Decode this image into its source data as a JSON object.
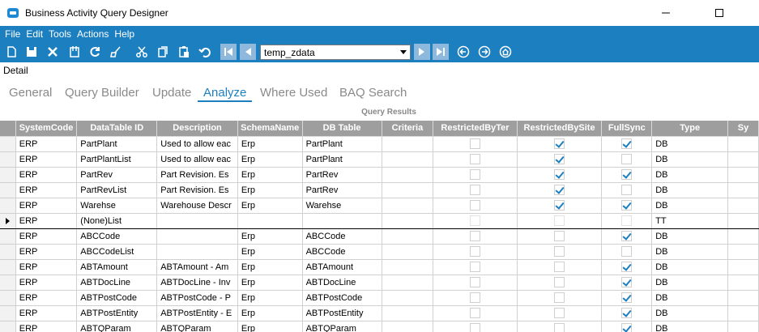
{
  "window": {
    "title": "Business Activity Query Designer"
  },
  "menu": [
    "File",
    "Edit",
    "Tools",
    "Actions",
    "Help"
  ],
  "toolbar": {
    "dataset_value": "temp_zdata"
  },
  "detail_label": "Detail",
  "tabs": [
    "General",
    "Query Builder",
    "Update",
    "Analyze",
    "Where Used",
    "BAQ Search"
  ],
  "active_tab": "Analyze",
  "results_label": "Query Results",
  "grid": {
    "columns": [
      "SystemCode",
      "DataTable ID",
      "Description",
      "SchemaName",
      "DB Table",
      "Criteria",
      "RestrictedByTer",
      "RestrictedBySite",
      "FullSync",
      "Type",
      "Sy"
    ],
    "rows": [
      {
        "sys": "ERP",
        "dt": "PartPlant",
        "desc": "Used to allow eac",
        "schema": "Erp",
        "db": "PartPlant",
        "crit": "",
        "rter": false,
        "rsite": true,
        "full": true,
        "type": "DB",
        "current": false
      },
      {
        "sys": "ERP",
        "dt": "PartPlantList",
        "desc": "Used to allow eac",
        "schema": "Erp",
        "db": "PartPlant",
        "crit": "",
        "rter": false,
        "rsite": true,
        "full": false,
        "type": "DB",
        "current": false
      },
      {
        "sys": "ERP",
        "dt": "PartRev",
        "desc": "Part Revision.  Es",
        "schema": "Erp",
        "db": "PartRev",
        "crit": "",
        "rter": false,
        "rsite": true,
        "full": true,
        "type": "DB",
        "current": false
      },
      {
        "sys": "ERP",
        "dt": "PartRevList",
        "desc": "Part Revision.  Es",
        "schema": "Erp",
        "db": "PartRev",
        "crit": "",
        "rter": false,
        "rsite": true,
        "full": false,
        "type": "DB",
        "current": false
      },
      {
        "sys": "ERP",
        "dt": "Warehse",
        "desc": "Warehouse Descr",
        "schema": "Erp",
        "db": "Warehse",
        "crit": "",
        "rter": false,
        "rsite": true,
        "full": true,
        "type": "DB",
        "current": false
      },
      {
        "sys": "ERP",
        "dt": "(None)List",
        "desc": "",
        "schema": "",
        "db": "",
        "crit": "",
        "rter": false,
        "rsite": false,
        "full": false,
        "type": "TT",
        "current": true
      },
      {
        "sys": "ERP",
        "dt": "ABCCode",
        "desc": "",
        "schema": "Erp",
        "db": "ABCCode",
        "crit": "",
        "rter": false,
        "rsite": false,
        "full": true,
        "type": "DB",
        "current": false
      },
      {
        "sys": "ERP",
        "dt": "ABCCodeList",
        "desc": "",
        "schema": "Erp",
        "db": "ABCCode",
        "crit": "",
        "rter": false,
        "rsite": false,
        "full": false,
        "type": "DB",
        "current": false
      },
      {
        "sys": "ERP",
        "dt": "ABTAmount",
        "desc": "ABTAmount - Am",
        "schema": "Erp",
        "db": "ABTAmount",
        "crit": "",
        "rter": false,
        "rsite": false,
        "full": true,
        "type": "DB",
        "current": false
      },
      {
        "sys": "ERP",
        "dt": "ABTDocLine",
        "desc": "ABTDocLine - Inv",
        "schema": "Erp",
        "db": "ABTDocLine",
        "crit": "",
        "rter": false,
        "rsite": false,
        "full": true,
        "type": "DB",
        "current": false
      },
      {
        "sys": "ERP",
        "dt": "ABTPostCode",
        "desc": "ABTPostCode - P",
        "schema": "Erp",
        "db": "ABTPostCode",
        "crit": "",
        "rter": false,
        "rsite": false,
        "full": true,
        "type": "DB",
        "current": false
      },
      {
        "sys": "ERP",
        "dt": "ABTPostEntity",
        "desc": "ABTPostEntity - E",
        "schema": "Erp",
        "db": "ABTPostEntity",
        "crit": "",
        "rter": false,
        "rsite": false,
        "full": true,
        "type": "DB",
        "current": false
      },
      {
        "sys": "ERP",
        "dt": "ABTQParam",
        "desc": "ABTQParam",
        "schema": "Erp",
        "db": "ABTQParam",
        "crit": "",
        "rter": false,
        "rsite": false,
        "full": true,
        "type": "DB",
        "current": false
      }
    ]
  },
  "colors": {
    "accent": "#1c7fbf",
    "header_bg": "#9e9e9e",
    "tab_inactive": "#8a8a8a"
  }
}
